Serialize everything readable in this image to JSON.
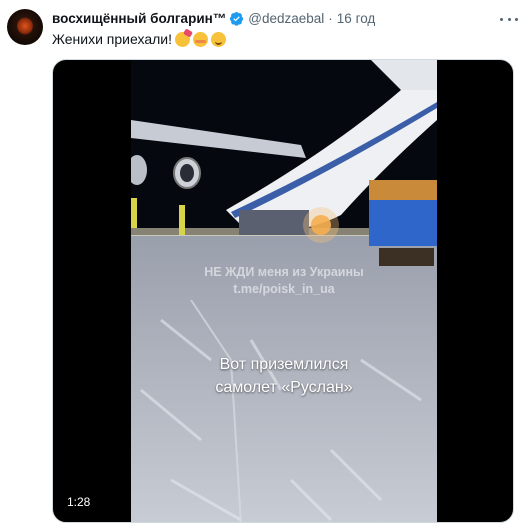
{
  "tweet": {
    "author_name": "восхищённый болгарин™",
    "handle": "@dedzaebal",
    "separator": "·",
    "time": "16 год",
    "text": "Женихи приехали!",
    "emojis": [
      "partying-face",
      "smiling-face-with-smiling-eyes",
      "blush-face"
    ],
    "verified": true
  },
  "video": {
    "watermark_line1": "НЕ ЖДИ меня из Украины",
    "watermark_line2": "t.me/poisk_in_ua",
    "caption_line1": "Вот приземлился",
    "caption_line2": "самолет «Руслан»",
    "duration": "1:28"
  },
  "colors": {
    "text_primary": "#0f1419",
    "text_secondary": "#536471",
    "verified_blue": "#1d9bf0",
    "media_border": "#cfd9de"
  }
}
